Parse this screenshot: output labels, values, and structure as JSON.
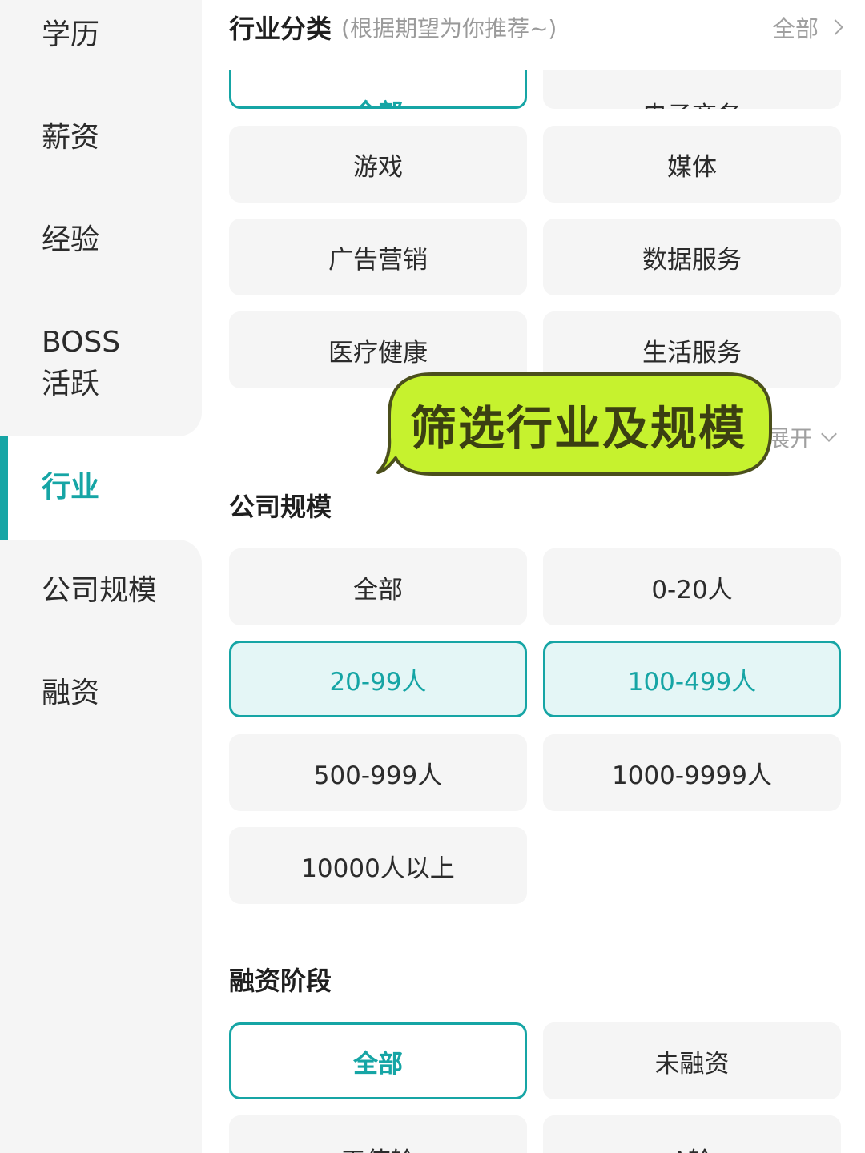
{
  "sidebar": {
    "items": [
      {
        "label": "学历"
      },
      {
        "label": "薪资"
      },
      {
        "label": "经验"
      },
      {
        "label": "BOSS\n活跃"
      },
      {
        "label": "行业"
      },
      {
        "label": "公司规模"
      },
      {
        "label": "融资"
      }
    ],
    "active_index": 4
  },
  "industry": {
    "title": "行业分类",
    "hint": "(根据期望为你推荐~)",
    "all_label": "全部",
    "options": [
      "全部",
      "电子商务",
      "游戏",
      "媒体",
      "广告营销",
      "数据服务",
      "医疗健康",
      "生活服务"
    ],
    "selected": [
      "全部"
    ],
    "expand_label": "展开"
  },
  "company_size": {
    "title": "公司规模",
    "options": [
      "全部",
      "0-20人",
      "20-99人",
      "100-499人",
      "500-999人",
      "1000-9999人",
      "10000人以上"
    ],
    "selected": [
      "20-99人",
      "100-499人"
    ]
  },
  "financing": {
    "title": "融资阶段",
    "options": [
      "全部",
      "未融资",
      "天使轮",
      "A轮"
    ],
    "selected": [
      "全部"
    ]
  },
  "callout": {
    "text": "筛选行业及规模"
  },
  "colors": {
    "accent": "#16a5a5",
    "selected_bg": "#e4f6f6",
    "chip_bg": "#f5f5f5",
    "callout_fill": "#c6f22e",
    "callout_stroke": "#4b4f1c"
  }
}
